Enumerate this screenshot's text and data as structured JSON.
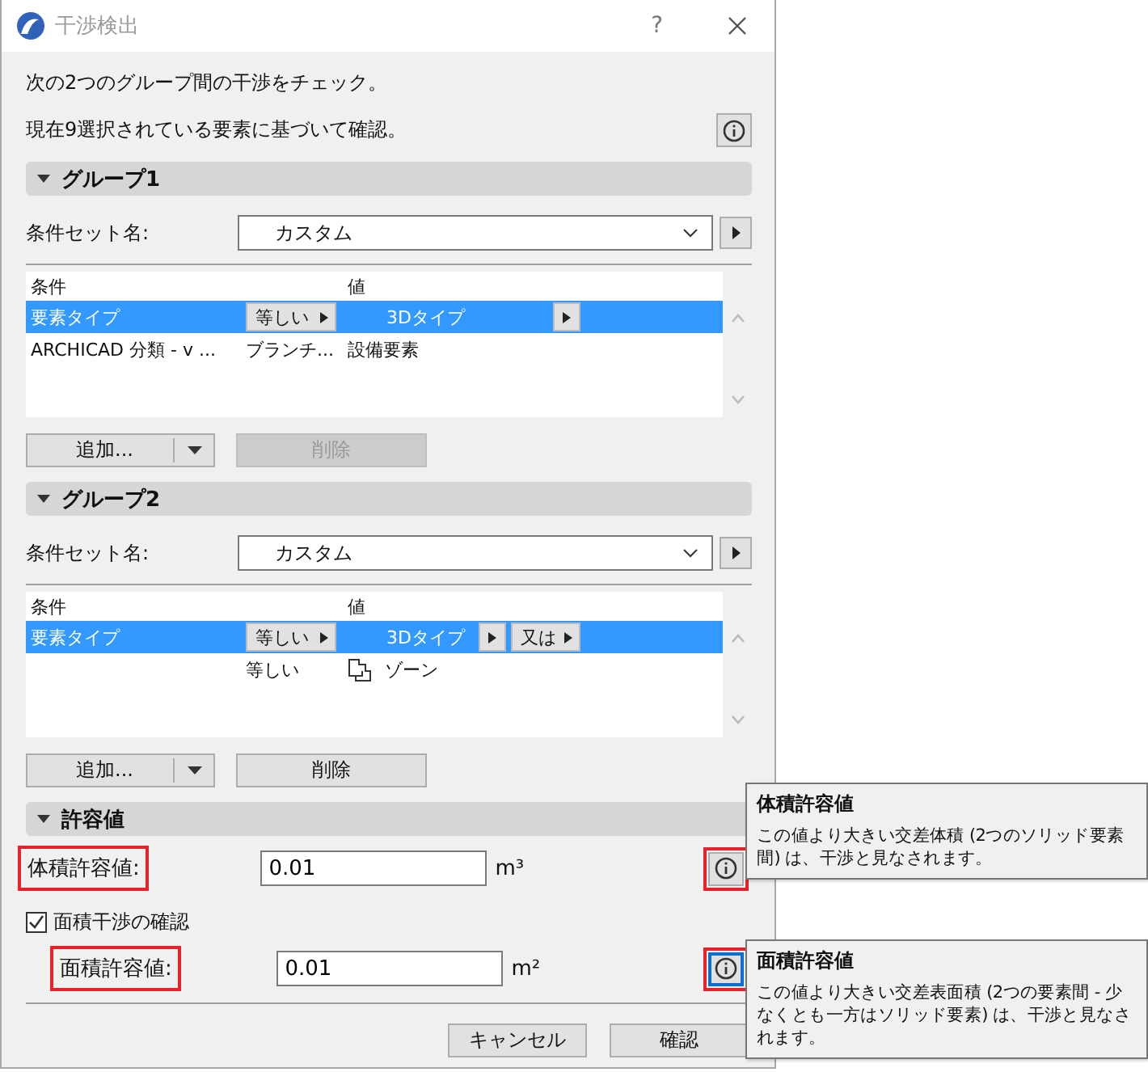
{
  "window": {
    "title": "干渉検出",
    "help": "?"
  },
  "intro": "次の2つのグループ間の干渉をチェック。",
  "selection_note": "現在9選択されている要素に基づいて確認。",
  "groups": [
    {
      "title": "グループ1",
      "expanded": true,
      "condition_set_label": "条件セット名:",
      "condition_set": "カスタム",
      "columns": {
        "condition": "条件",
        "value": "値"
      },
      "rows": [
        {
          "condition": "要素タイプ",
          "operator": "等しい",
          "value": "3Dタイプ",
          "selected": true
        },
        {
          "condition": "ARCHICAD 分類 - v ...",
          "operator": "ブランチ...",
          "value": "設備要素",
          "selected": false
        }
      ],
      "add_button": "追加...",
      "delete_button": {
        "label": "削除",
        "disabled": true
      }
    },
    {
      "title": "グループ2",
      "expanded": true,
      "condition_set_label": "条件セット名:",
      "condition_set": "カスタム",
      "columns": {
        "condition": "条件",
        "value": "値"
      },
      "rows": [
        {
          "condition": "要素タイプ",
          "operator": "等しい",
          "value": "3Dタイプ",
          "or_button": "又は",
          "selected": true
        },
        {
          "operator": "等しい",
          "value": "ゾーン",
          "icon": true,
          "selected": false
        }
      ],
      "add_button": "追加...",
      "delete_button": {
        "label": "削除",
        "disabled": false
      }
    }
  ],
  "tolerance": {
    "title": "許容値",
    "expanded": true,
    "volume": {
      "label": "体積許容値:",
      "highlighted": true,
      "value": "0.01",
      "unit": "m³",
      "info_focused": false
    },
    "area_check": {
      "label": "面積干渉の確認",
      "checked": true
    },
    "area": {
      "label": "面積許容値:",
      "highlighted": true,
      "value": "0.01",
      "unit": "m²",
      "info_focused": true
    }
  },
  "tooltips": [
    {
      "title": "体積許容値",
      "text": "この値より大きい交差体積 (2つのソリッド要素間) は、干渉と見なされます。"
    },
    {
      "title": "面積許容値",
      "text": "この値より大きい交差表面積 (2つの要素間 - 少なくとも一方はソリッド要素) は、干渉と見なされます。"
    }
  ],
  "buttons": [
    "キャンセル",
    "確認"
  ]
}
